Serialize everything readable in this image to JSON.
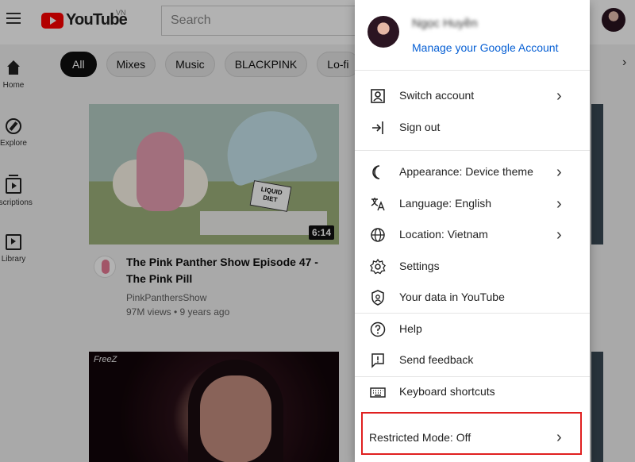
{
  "header": {
    "logo_text": "YouTube",
    "region": "VN",
    "search_placeholder": "Search"
  },
  "chips": [
    "All",
    "Mixes",
    "Music",
    "BLACKPINK",
    "Lo-fi"
  ],
  "nav": [
    {
      "label": "Home",
      "icon": "home-icon"
    },
    {
      "label": "Explore",
      "icon": "explore-icon"
    },
    {
      "label": "bscriptions",
      "icon": "subscriptions-icon"
    },
    {
      "label": "Library",
      "icon": "library-icon"
    }
  ],
  "videos": [
    {
      "title": "The Pink Panther Show Episode 47 - The Pink Pill",
      "channel": "PinkPanthersShow",
      "meta": "97M views • 9 years ago",
      "duration": "6:14",
      "thumb_sign": "LIQUID DIET"
    },
    {
      "thumb_brand": "FreeZ"
    }
  ],
  "menu": {
    "account_name": "Ngọc Huyền",
    "manage_link": "Manage your Google Account",
    "items": [
      {
        "label": "Switch account",
        "icon": "switch-account-icon",
        "chevron": true
      },
      {
        "label": "Sign out",
        "icon": "sign-out-icon",
        "chevron": false
      },
      {
        "label": "Appearance: Device theme",
        "icon": "appearance-icon",
        "chevron": true
      },
      {
        "label": "Language: English",
        "icon": "language-icon",
        "chevron": true
      },
      {
        "label": "Location: Vietnam",
        "icon": "globe-icon",
        "chevron": true
      },
      {
        "label": "Settings",
        "icon": "gear-icon",
        "chevron": false
      },
      {
        "label": "Your data in YouTube",
        "icon": "shield-icon",
        "chevron": false
      },
      {
        "label": "Help",
        "icon": "help-icon",
        "chevron": false
      },
      {
        "label": "Send feedback",
        "icon": "feedback-icon",
        "chevron": false
      },
      {
        "label": "Keyboard shortcuts",
        "icon": "keyboard-icon",
        "chevron": false
      }
    ],
    "restricted_mode": "Restricted Mode: Off"
  },
  "colors": {
    "brand_red": "#ff0000",
    "link_blue": "#065fd4",
    "highlight_border": "#e02020"
  }
}
